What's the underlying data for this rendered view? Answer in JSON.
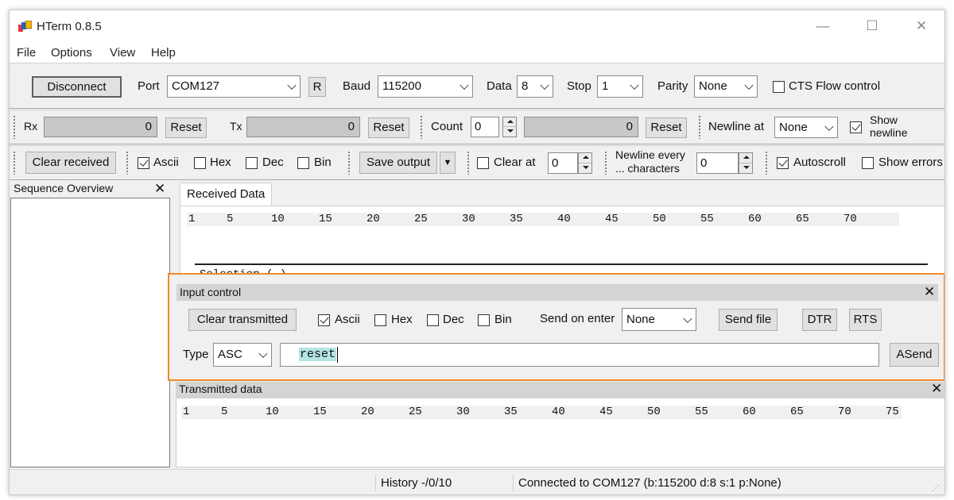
{
  "window": {
    "title": "HTerm 0.8.5"
  },
  "menu": [
    "File",
    "Options",
    "View",
    "Help"
  ],
  "connection": {
    "disconnect_label": "Disconnect",
    "port_label": "Port",
    "port_value": "COM127",
    "r_label": "R",
    "baud_label": "Baud",
    "baud_value": "115200",
    "data_label": "Data",
    "data_value": "8",
    "stop_label": "Stop",
    "stop_value": "1",
    "parity_label": "Parity",
    "parity_value": "None",
    "cts_label": "CTS Flow control",
    "cts_checked": false
  },
  "counters": {
    "rx_label": "Rx",
    "rx_value": "0",
    "rx_reset": "Reset",
    "tx_label": "Tx",
    "tx_value": "0",
    "tx_reset": "Reset",
    "count_label": "Count",
    "count_input": "0",
    "count_value": "0",
    "count_reset": "Reset",
    "newline_at_label": "Newline at",
    "newline_at_value": "None",
    "show_newline_label": "Show newline",
    "show_newline_checked": true
  },
  "receive_options": {
    "clear_received": "Clear received",
    "ascii": "Ascii",
    "ascii_checked": true,
    "hex": "Hex",
    "dec": "Dec",
    "bin": "Bin",
    "save_output": "Save output",
    "clear_at_label": "Clear at",
    "clear_at_value": "0",
    "newline_every_label_1": "Newline every",
    "newline_every_label_2": "... characters",
    "newline_every_value": "0",
    "autoscroll": "Autoscroll",
    "autoscroll_checked": true,
    "show_errors": "Show errors"
  },
  "sequence_overview": {
    "title": "Sequence Overview"
  },
  "received": {
    "tab": "Received Data",
    "ruler": [
      "1",
      "5",
      "10",
      "15",
      "20",
      "25",
      "30",
      "35",
      "40",
      "45",
      "50",
      "55",
      "60",
      "65",
      "70"
    ],
    "selection": "Selection (-)"
  },
  "input_control": {
    "title": "Input control",
    "clear_transmitted": "Clear transmitted",
    "ascii": "Ascii",
    "ascii_checked": true,
    "hex": "Hex",
    "dec": "Dec",
    "bin": "Bin",
    "send_on_enter_label": "Send on enter",
    "send_on_enter_value": "None",
    "send_file": "Send file",
    "dtr": "DTR",
    "rts": "RTS",
    "type_label": "Type",
    "type_value": "ASC",
    "input_value": "reset",
    "asend": "ASend",
    "highlight_color": "#f0892a"
  },
  "transmitted": {
    "title": "Transmitted data",
    "ruler": [
      "1",
      "5",
      "10",
      "15",
      "20",
      "25",
      "30",
      "35",
      "40",
      "45",
      "50",
      "55",
      "60",
      "65",
      "70",
      "75"
    ]
  },
  "status": {
    "history": "History -/0/10",
    "connection": "Connected to COM127 (b:115200 d:8 s:1 p:None)"
  }
}
